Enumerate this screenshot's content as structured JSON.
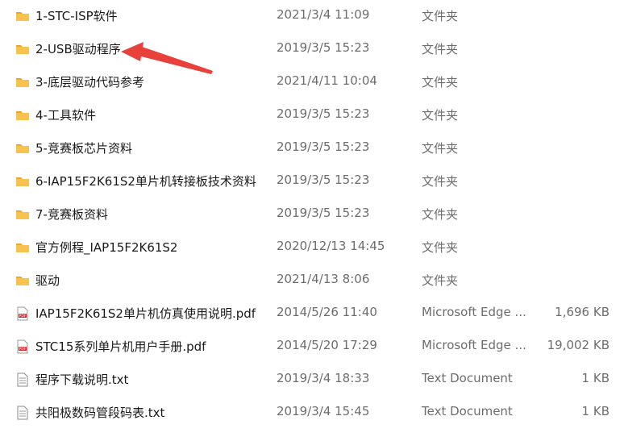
{
  "files": [
    {
      "name": "1-STC-ISP软件",
      "modified": "2021/3/4 11:09",
      "type": "文件夹",
      "size": "",
      "icon": "folder-icon"
    },
    {
      "name": "2-USB驱动程序",
      "modified": "2019/3/5 15:23",
      "type": "文件夹",
      "size": "",
      "icon": "folder-icon"
    },
    {
      "name": "3-底层驱动代码参考",
      "modified": "2021/4/11 10:04",
      "type": "文件夹",
      "size": "",
      "icon": "folder-icon"
    },
    {
      "name": "4-工具软件",
      "modified": "2019/3/5 15:23",
      "type": "文件夹",
      "size": "",
      "icon": "folder-icon"
    },
    {
      "name": "5-竞赛板芯片资料",
      "modified": "2019/3/5 15:23",
      "type": "文件夹",
      "size": "",
      "icon": "folder-icon"
    },
    {
      "name": "6-IAP15F2K61S2单片机转接板技术资料",
      "modified": "2019/3/5 15:23",
      "type": "文件夹",
      "size": "",
      "icon": "folder-icon"
    },
    {
      "name": "7-竞赛板资料",
      "modified": "2019/3/5 15:23",
      "type": "文件夹",
      "size": "",
      "icon": "folder-icon"
    },
    {
      "name": "官方例程_IAP15F2K61S2",
      "modified": "2020/12/13 14:45",
      "type": "文件夹",
      "size": "",
      "icon": "folder-icon"
    },
    {
      "name": "驱动",
      "modified": "2021/4/13 8:06",
      "type": "文件夹",
      "size": "",
      "icon": "folder-icon"
    },
    {
      "name": "IAP15F2K61S2单片机仿真使用说明.pdf",
      "modified": "2014/5/26 11:40",
      "type": "Microsoft Edge ...",
      "size": "1,696 KB",
      "icon": "pdf-icon"
    },
    {
      "name": "STC15系列单片机用户手册.pdf",
      "modified": "2014/5/20 17:29",
      "type": "Microsoft Edge ...",
      "size": "19,002 KB",
      "icon": "pdf-icon"
    },
    {
      "name": "程序下载说明.txt",
      "modified": "2019/3/4 18:33",
      "type": "Text Document",
      "size": "1 KB",
      "icon": "text-file-icon"
    },
    {
      "name": "共阳极数码管段码表.txt",
      "modified": "2019/3/4 15:45",
      "type": "Text Document",
      "size": "1 KB",
      "icon": "text-file-icon"
    }
  ],
  "annotation": {
    "color": "#e8403a",
    "icon": "red-arrow-annotation"
  },
  "colors": {
    "folder": "#f7c24d",
    "folder_dark": "#e5a92b",
    "pdf": "#d9262b"
  }
}
